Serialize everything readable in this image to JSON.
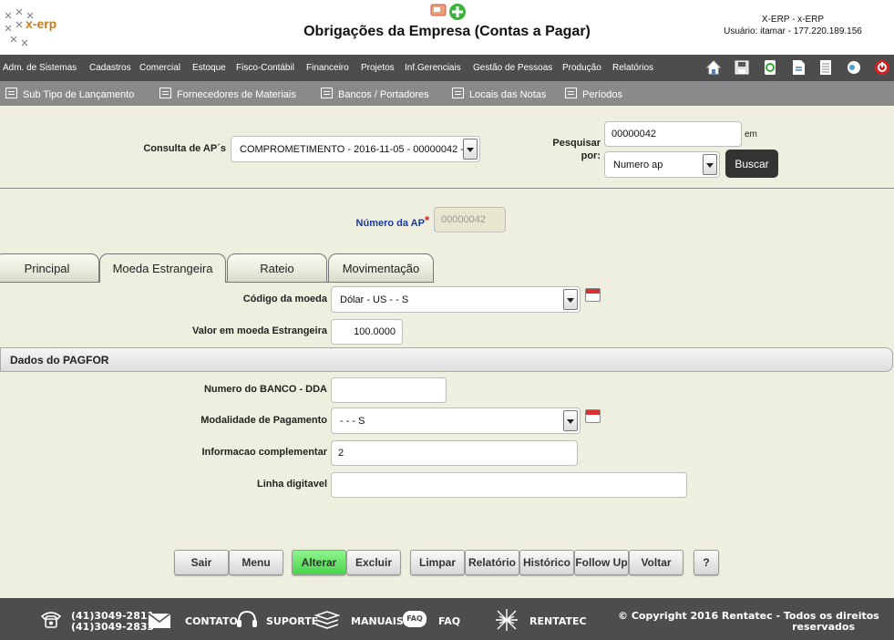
{
  "header": {
    "logo_text": "x-erp",
    "title": "Obrigações da Empresa (Contas a Pagar)",
    "system_name": "X-ERP - x-ERP",
    "user_info": "Usuário: itamar - 177.220.189.156"
  },
  "main_menu": {
    "items": [
      "Adm. de Sistemas",
      "Cadastros",
      "Comercial",
      "Estoque",
      "Fisco-Contábil",
      "Financeiro",
      "Projetos",
      "Inf.Gerenciais",
      "Gestão de Pessoas",
      "Produção",
      "Relatórios"
    ],
    "icons": [
      "home-icon",
      "save-icon",
      "recycle-icon",
      "document-icon",
      "list-icon",
      "chat-icon",
      "power-icon"
    ]
  },
  "sub_menu": {
    "items": [
      "Sub Tipo de Lançamento",
      "Fornecedores de Materiais",
      "Bancos / Portadores",
      "Locais das Notas",
      "Períodos"
    ]
  },
  "search": {
    "consulta_label": "Consulta de AP´s",
    "consulta_value": "COMPROMETIMENTO - 2016-11-05 - 00000042 -",
    "pesquisar_label_1": "Pesquisar",
    "pesquisar_label_2": "por:",
    "search_value": "00000042",
    "em_label": "em",
    "search_by_value": "Numero ap",
    "buscar_label": "Buscar"
  },
  "ap_number": {
    "label": "Número da AP",
    "required_mark": "*",
    "value": "00000042"
  },
  "tabs": [
    {
      "label": "Principal",
      "active": false
    },
    {
      "label": "Moeda Estrangeira",
      "active": true
    },
    {
      "label": "Rateio",
      "active": false
    },
    {
      "label": "Movimentação",
      "active": false
    }
  ],
  "moeda": {
    "codigo_label": "Código da moeda",
    "codigo_value": "Dólar - US - - S",
    "valor_label": "Valor em moeda Estrangeira",
    "valor_value": "100.0000"
  },
  "pagfor": {
    "section_title": "Dados do PAGFOR",
    "banco_label": "Numero do BANCO - DDA",
    "banco_value": "",
    "modalidade_label": "Modalidade de Pagamento",
    "modalidade_value": "- - - S",
    "info_label": "Informacao complementar",
    "info_value": "2",
    "linha_label": "Linha digitavel",
    "linha_value": ""
  },
  "actions": [
    "Sair",
    "Menu",
    "Alterar",
    "Excluir",
    "Limpar",
    "Relatório",
    "Histórico",
    "Follow Up",
    "Voltar",
    "?"
  ],
  "footer": {
    "phone_1": "(41)3049-2811",
    "phone_2": "(41)3049-2833",
    "contato": "CONTATO",
    "suporte": "SUPORTE",
    "manuais": "MANUAIS",
    "faq_badge": "FAQ",
    "faq": "FAQ",
    "rentatec": "RENTATEC",
    "copyright_1": "© Copyright 2016 Rentatec - Todos os direitos",
    "copyright_2": "reservados"
  },
  "colors": {
    "page_bg": "#efefdf",
    "menu_bg": "#4d4d4d",
    "submenu_bg": "#8a8a8a",
    "accent_green": "#4ad34a",
    "brand_orange": "#c87a1c"
  }
}
